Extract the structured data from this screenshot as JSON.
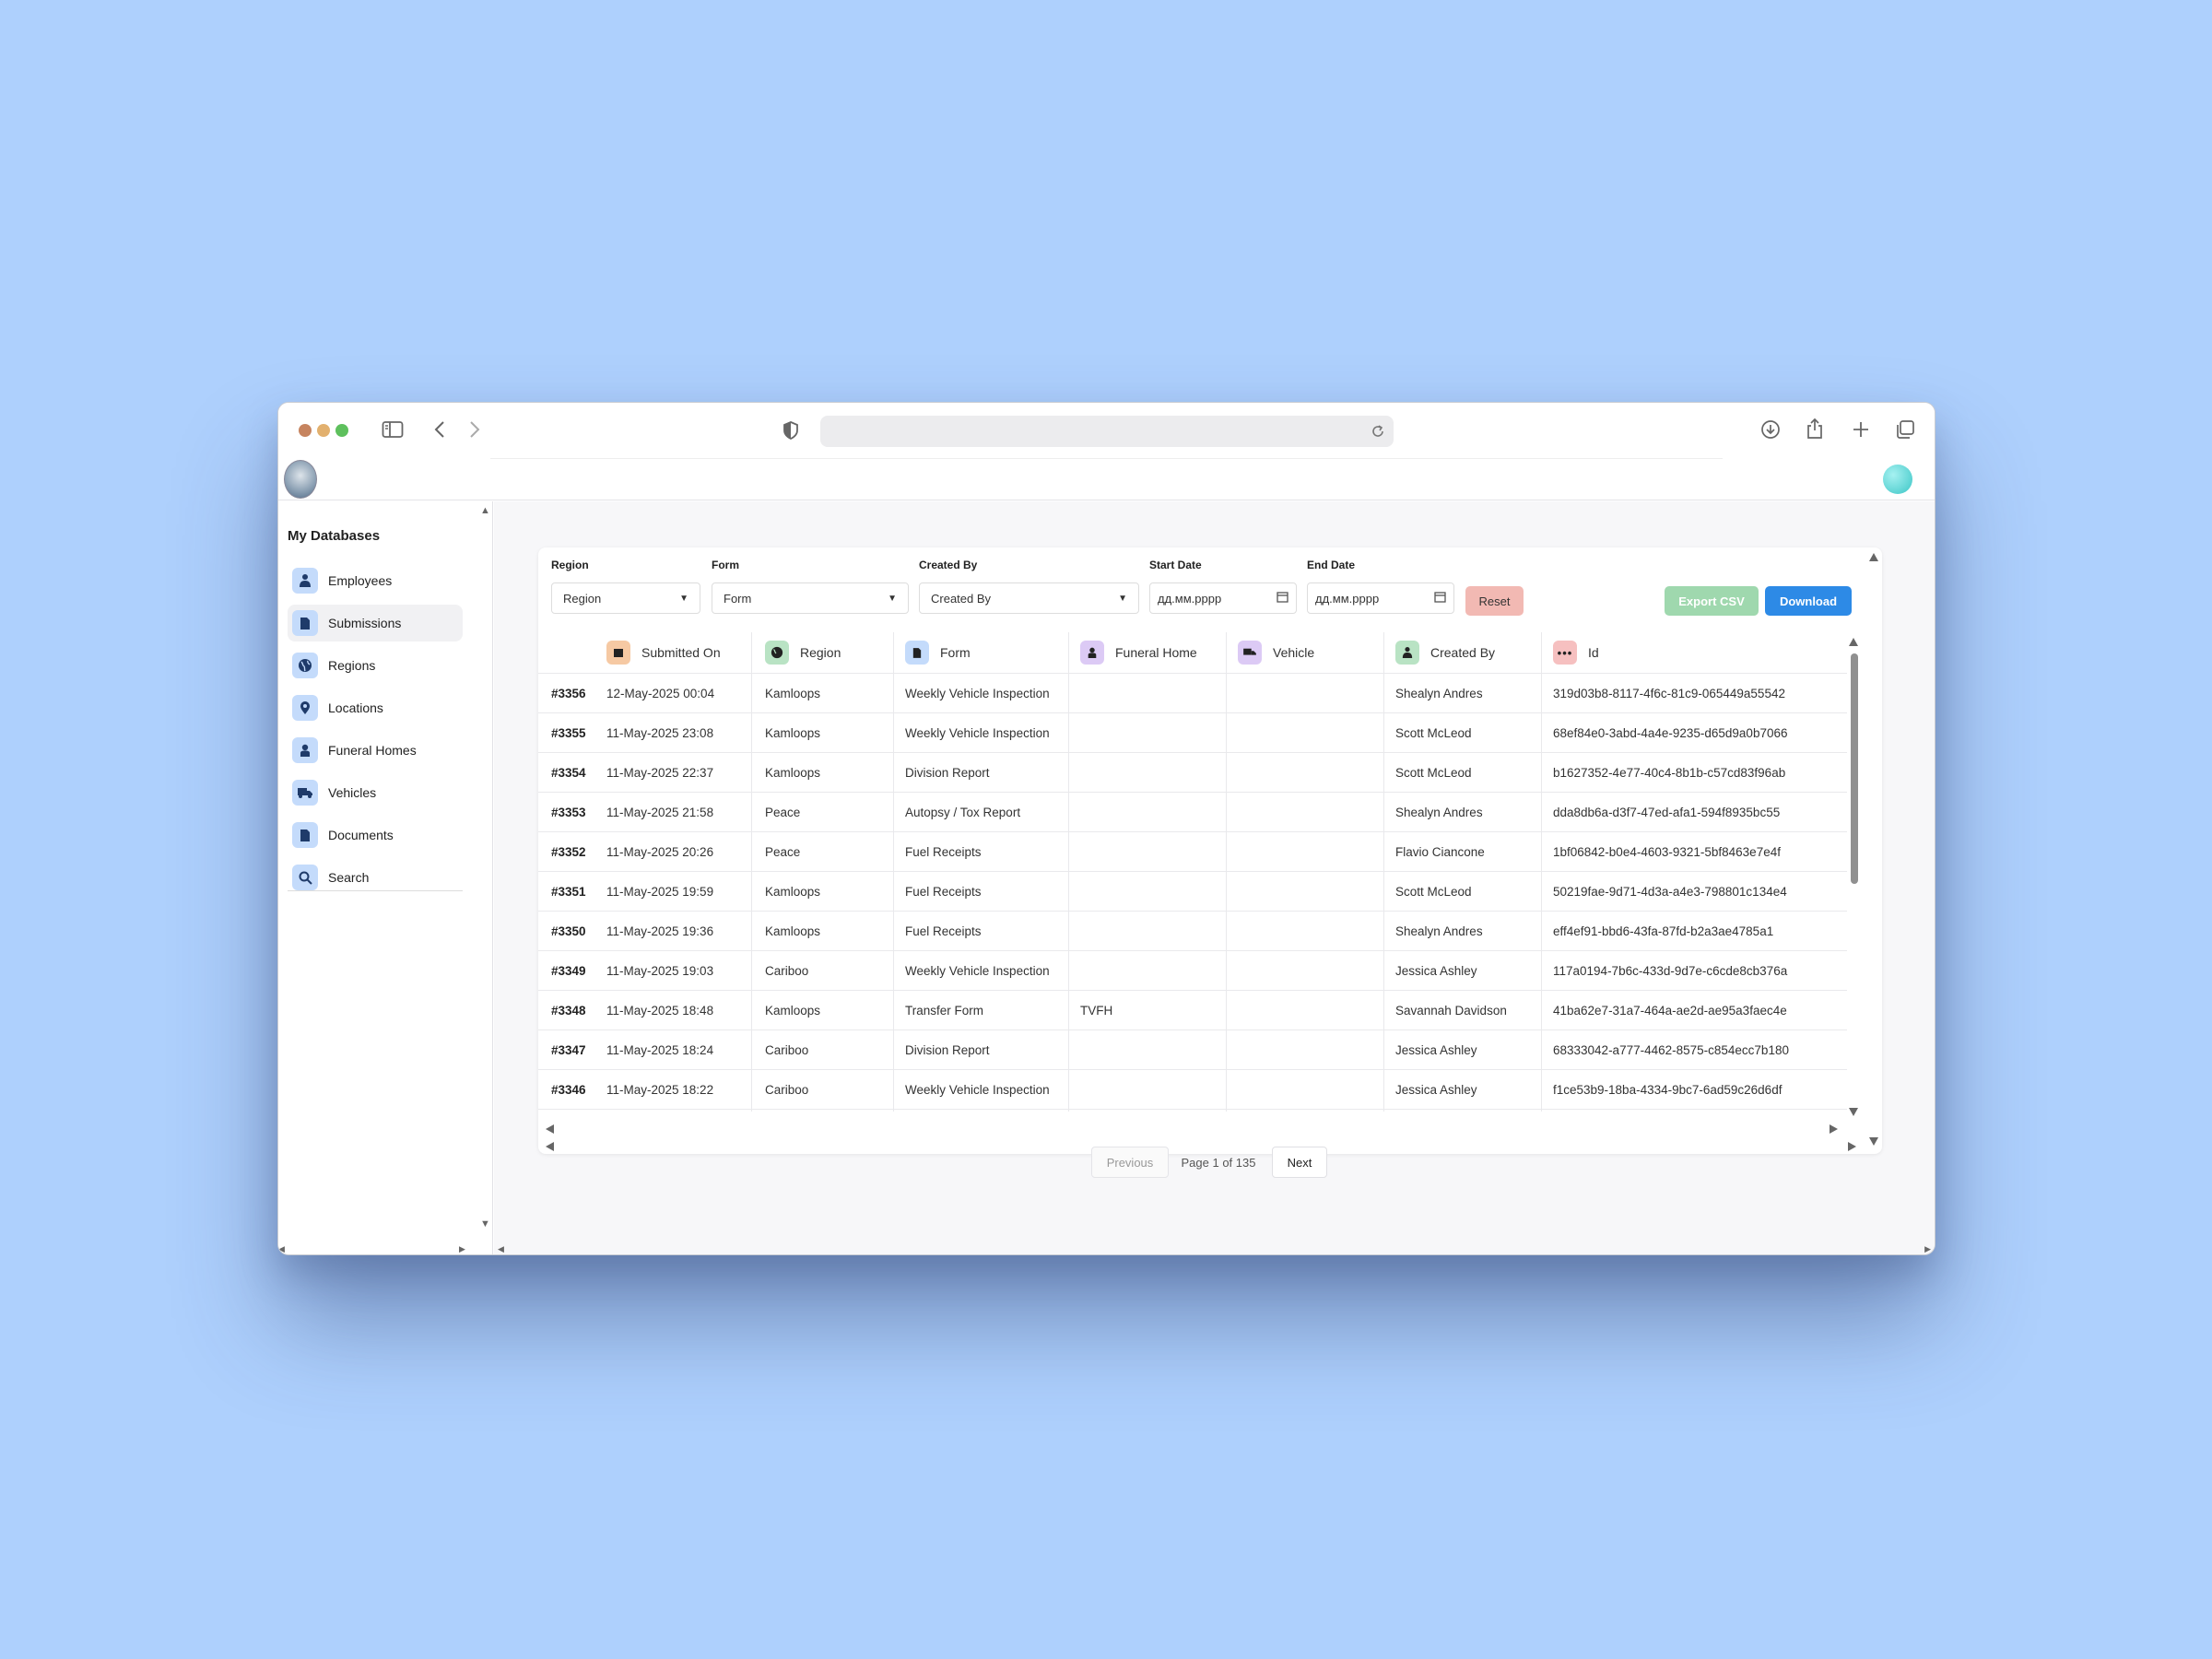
{
  "sidebar": {
    "heading": "My Databases",
    "items": [
      {
        "label": "Employees",
        "icon": "person-icon"
      },
      {
        "label": "Submissions",
        "icon": "document-icon"
      },
      {
        "label": "Regions",
        "icon": "globe-icon"
      },
      {
        "label": "Locations",
        "icon": "pin-icon"
      },
      {
        "label": "Funeral Homes",
        "icon": "person-badge-icon"
      },
      {
        "label": "Vehicles",
        "icon": "truck-icon"
      },
      {
        "label": "Documents",
        "icon": "document-icon"
      },
      {
        "label": "Search",
        "icon": "search-icon"
      }
    ],
    "active": "Submissions"
  },
  "filters": {
    "region_label": "Region",
    "region_value": "Region",
    "form_label": "Form",
    "form_value": "Form",
    "created_by_label": "Created By",
    "created_by_value": "Created By",
    "start_date_label": "Start Date",
    "start_date_placeholder": "дд.мм.рррр",
    "end_date_label": "End Date",
    "end_date_placeholder": "дд.мм.рррр",
    "reset": "Reset"
  },
  "actions": {
    "export_csv": "Export CSV",
    "download": "Download"
  },
  "table": {
    "columns": [
      {
        "label": "Submitted On",
        "icon": "calendar-icon",
        "color": "#f6c9a3"
      },
      {
        "label": "Region",
        "icon": "globe-icon",
        "color": "#b9e3c4"
      },
      {
        "label": "Form",
        "icon": "document-icon",
        "color": "#c4dbfb"
      },
      {
        "label": "Funeral Home",
        "icon": "person-badge-icon",
        "color": "#dccaf5"
      },
      {
        "label": "Vehicle",
        "icon": "truck-icon",
        "color": "#dccaf5"
      },
      {
        "label": "Created By",
        "icon": "person-icon",
        "color": "#b9e3c4"
      },
      {
        "label": "Id",
        "icon": "dots-icon",
        "color": "#f6c0c0"
      }
    ],
    "rows": [
      {
        "num": "#3356",
        "date": "12-May-2025 00:04",
        "region": "Kamloops",
        "form": "Weekly Vehicle Inspection",
        "home": "",
        "vehicle": "",
        "by": "Shealyn Andres",
        "id": "319d03b8-8117-4f6c-81c9-065449a55542"
      },
      {
        "num": "#3355",
        "date": "11-May-2025 23:08",
        "region": "Kamloops",
        "form": "Weekly Vehicle Inspection",
        "home": "",
        "vehicle": "",
        "by": "Scott McLeod",
        "id": "68ef84e0-3abd-4a4e-9235-d65d9a0b7066"
      },
      {
        "num": "#3354",
        "date": "11-May-2025 22:37",
        "region": "Kamloops",
        "form": "Division Report",
        "home": "",
        "vehicle": "",
        "by": "Scott McLeod",
        "id": "b1627352-4e77-40c4-8b1b-c57cd83f96ab"
      },
      {
        "num": "#3353",
        "date": "11-May-2025 21:58",
        "region": "Peace",
        "form": "Autopsy / Tox Report",
        "home": "",
        "vehicle": "",
        "by": "Shealyn Andres",
        "id": "dda8db6a-d3f7-47ed-afa1-594f8935bc55"
      },
      {
        "num": "#3352",
        "date": "11-May-2025 20:26",
        "region": "Peace",
        "form": "Fuel Receipts",
        "home": "",
        "vehicle": "",
        "by": "Flavio Ciancone",
        "id": "1bf06842-b0e4-4603-9321-5bf8463e7e4f"
      },
      {
        "num": "#3351",
        "date": "11-May-2025 19:59",
        "region": "Kamloops",
        "form": "Fuel Receipts",
        "home": "",
        "vehicle": "",
        "by": "Scott McLeod",
        "id": "50219fae-9d71-4d3a-a4e3-798801c134e4"
      },
      {
        "num": "#3350",
        "date": "11-May-2025 19:36",
        "region": "Kamloops",
        "form": "Fuel Receipts",
        "home": "",
        "vehicle": "",
        "by": "Shealyn Andres",
        "id": "eff4ef91-bbd6-43fa-87fd-b2a3ae4785a1"
      },
      {
        "num": "#3349",
        "date": "11-May-2025 19:03",
        "region": "Cariboo",
        "form": "Weekly Vehicle Inspection",
        "home": "",
        "vehicle": "",
        "by": "Jessica Ashley",
        "id": "117a0194-7b6c-433d-9d7e-c6cde8cb376a"
      },
      {
        "num": "#3348",
        "date": "11-May-2025 18:48",
        "region": "Kamloops",
        "form": "Transfer Form",
        "home": "TVFH",
        "vehicle": "",
        "by": "Savannah Davidson",
        "id": "41ba62e7-31a7-464a-ae2d-ae95a3faec4e"
      },
      {
        "num": "#3347",
        "date": "11-May-2025 18:24",
        "region": "Cariboo",
        "form": "Division Report",
        "home": "",
        "vehicle": "",
        "by": "Jessica Ashley",
        "id": "68333042-a777-4462-8575-c854ecc7b180"
      },
      {
        "num": "#3346",
        "date": "11-May-2025 18:22",
        "region": "Cariboo",
        "form": "Weekly Vehicle Inspection",
        "home": "",
        "vehicle": "",
        "by": "Jessica Ashley",
        "id": "f1ce53b9-18ba-4334-9bc7-6ad59c26d6df"
      }
    ]
  },
  "pagination": {
    "previous": "Previous",
    "status": "Page 1 of 135",
    "next": "Next"
  },
  "colors": {
    "accent": "#2d8ae6",
    "export": "#9fd8ae",
    "reset": "#f2b9b3",
    "nav_icon_bg": "#c4dbfb"
  }
}
